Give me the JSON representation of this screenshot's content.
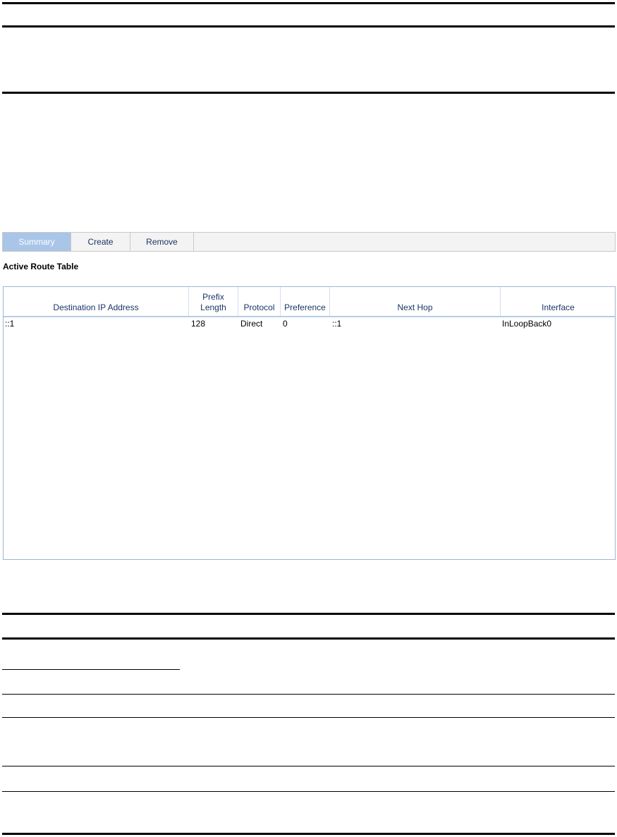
{
  "tabs": [
    {
      "label": "Summary",
      "active": true
    },
    {
      "label": "Create",
      "active": false
    },
    {
      "label": "Remove",
      "active": false
    }
  ],
  "section_title": "Active Route Table",
  "table": {
    "columns": [
      "Destination IP Address",
      "Prefix\nLength",
      "Protocol",
      "Preference",
      "Next Hop",
      "Interface"
    ],
    "rows": [
      [
        "::1",
        "128",
        "Direct",
        "0",
        "::1",
        "InLoopBack0"
      ]
    ]
  },
  "colors": {
    "tab_active_bg": "#a9c5e8",
    "header_text": "#1a3565",
    "panel_border": "#9cb6d6"
  }
}
